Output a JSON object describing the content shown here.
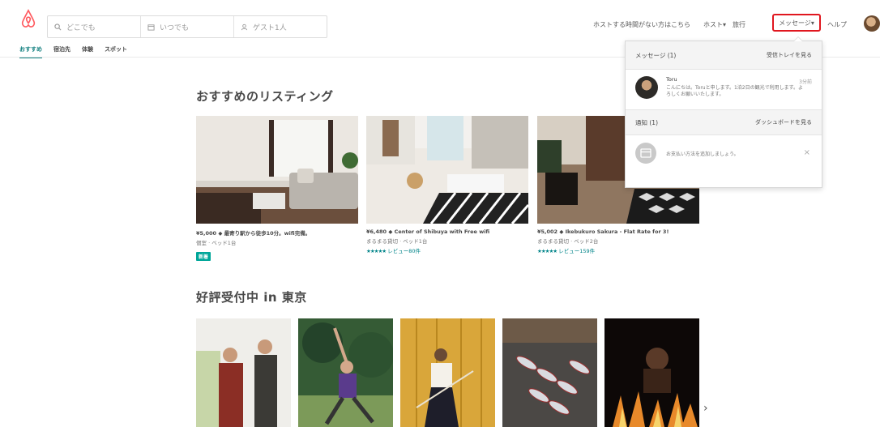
{
  "brand_color": "#ff5a5f",
  "accent_teal": "#008489",
  "highlight_red": "#e0171f",
  "header": {
    "logo_icon": "airbnb-logo-icon",
    "search": {
      "where": "どこでも",
      "when": "いつでも",
      "guests": "ゲスト1人"
    },
    "nav": {
      "host_link": "ホストする時間がない方はこちら",
      "host": "ホスト▾",
      "trips": "旅行",
      "messages": "メッセージ▾",
      "help": "ヘルプ"
    }
  },
  "tabs": [
    "おすすめ",
    "宿泊先",
    "体験",
    "スポット"
  ],
  "section1": {
    "title": "おすすめのリスティング"
  },
  "listings": [
    {
      "line1": "¥5,000 ◆ 最寄り駅から徒歩10分。wifi完備。",
      "line2": "個室 · ベッド1台",
      "stars": "★★★★★",
      "reviews": "",
      "badge": "新着"
    },
    {
      "line1": "¥6,480 ◆ Center of Shibuya with Free wifi",
      "line2": "まるまる貸切 · ベッド1台",
      "stars": "★★★★★",
      "reviews": "レビュー80件",
      "badge": ""
    },
    {
      "line1": "¥5,002 ◆ Ikebukuro Sakura - Flat Rate for 3!",
      "line2": "まるまる貸切 · ベッド2台",
      "stars": "★★★★★",
      "reviews": "レビュー159件",
      "badge": ""
    }
  ],
  "section2": {
    "title": "好評受付中 in 東京"
  },
  "next_arrow": "›",
  "dropdown": {
    "messages_header": "メッセージ (1)",
    "inbox_link": "受信トレイを見る",
    "message": {
      "sender": "Toru",
      "time": "3分前",
      "preview": "こんにちは。Toruと申します。1泊2日の観光で利用します。よろしくお願いいたします。"
    },
    "notifications_header": "通知 (1)",
    "dashboard_link": "ダッシュボードを見る",
    "notice": "お支払い方法を追加しましょう。",
    "close": "×"
  }
}
